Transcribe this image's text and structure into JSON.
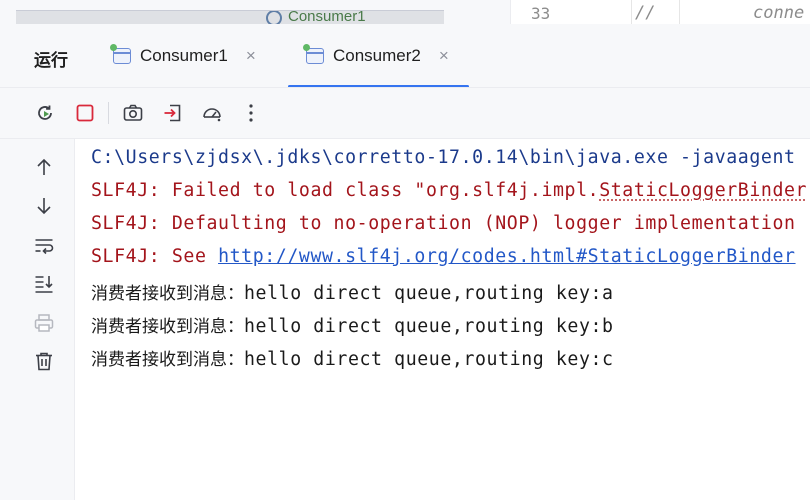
{
  "editor_strip": {
    "ghost_tab_label": "Consumer1",
    "line_number": "33",
    "comment_slashes": "//",
    "comment_text": "conne"
  },
  "panel": {
    "title": "运行",
    "tabs": [
      {
        "label": "Consumer1",
        "close": "×",
        "active": false
      },
      {
        "label": "Consumer2",
        "close": "×",
        "active": true
      }
    ],
    "accent_color": "#3574f0"
  },
  "toolbar": {
    "icons": [
      "rerun-icon",
      "stop-icon",
      "screenshot-camera-icon",
      "restore-layout-icon",
      "profiler-gauge-icon",
      "more-options-icon"
    ]
  },
  "gutter": {
    "icons": [
      "scroll-up-icon",
      "scroll-down-icon",
      "soft-wrap-icon",
      "scroll-to-end-icon",
      "print-icon",
      "clear-all-icon"
    ]
  },
  "console": {
    "cmd_line": "C:\\Users\\zjdsx\\.jdks\\corretto-17.0.14\\bin\\java.exe -javaagent",
    "err1_prefix": "SLF4J: Failed to load class \"org.slf4j.impl.",
    "err1_class": "StaticLoggerBinder",
    "err2": "SLF4J: Defaulting to no-operation (NOP) logger implementation",
    "err3_prefix": "SLF4J: See ",
    "err3_link": "http://www.slf4j.org/codes.html#StaticLoggerBinder",
    "out_prefix": "消费者接收到消息：",
    "out_lines": [
      "hello direct queue,routing key:a",
      "hello direct queue,routing key:b",
      "hello direct queue,routing key:c"
    ]
  }
}
